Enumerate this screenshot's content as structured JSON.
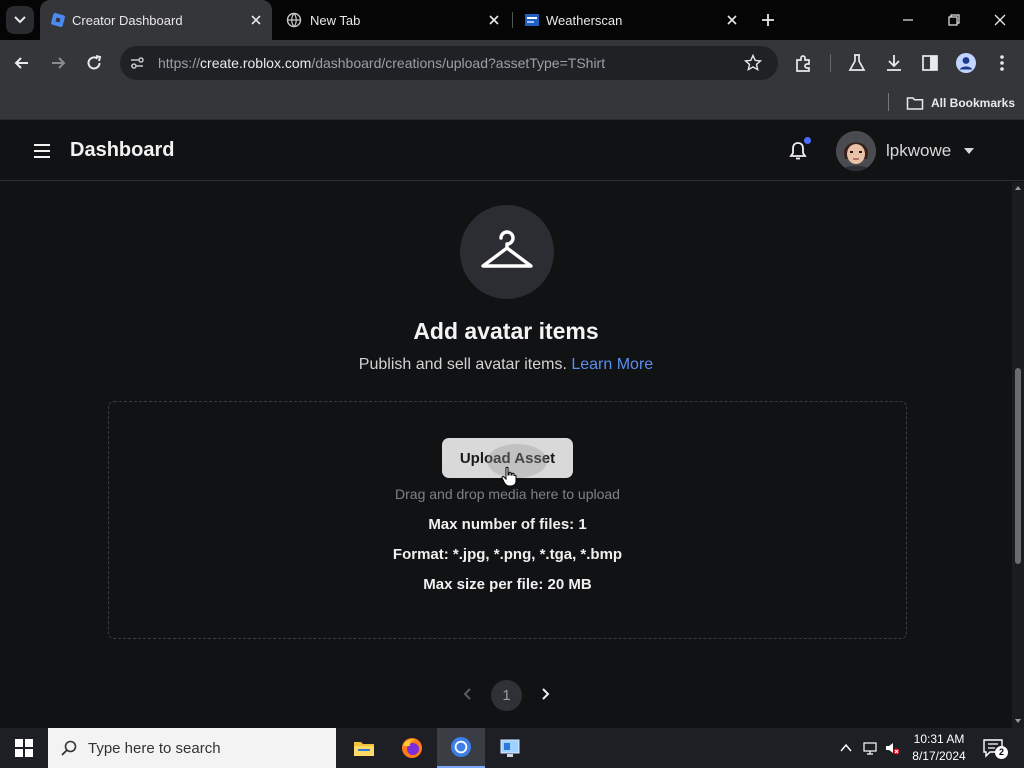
{
  "browser": {
    "tabs": [
      {
        "title": "Creator Dashboard",
        "active": true
      },
      {
        "title": "New Tab",
        "active": false
      },
      {
        "title": "Weatherscan",
        "active": false
      }
    ],
    "url_scheme": "https://",
    "url_host": "create.roblox.com",
    "url_path": "/dashboard/creations/upload?assetType=TShirt",
    "bookmarks_label": "All Bookmarks"
  },
  "header": {
    "title": "Dashboard",
    "username": "lpkwowe"
  },
  "main": {
    "heading": "Add avatar items",
    "subtext": "Publish and sell avatar items.",
    "learn_more": "Learn More",
    "upload_button": "Upload Asset",
    "dropzone_hint": "Drag and drop media here to upload",
    "max_files": "Max number of files: 1",
    "formats": "Format: *.jpg, *.png, *.tga, *.bmp",
    "max_size": "Max size per file: 20 MB"
  },
  "pagination": {
    "current_page": "1"
  },
  "taskbar": {
    "search_placeholder": "Type here to search",
    "time": "10:31 AM",
    "date": "8/17/2024",
    "notification_count": "2"
  },
  "colors": {
    "page_bg": "#111214",
    "link": "#5b8def",
    "bell_badge": "#4f6bff"
  }
}
